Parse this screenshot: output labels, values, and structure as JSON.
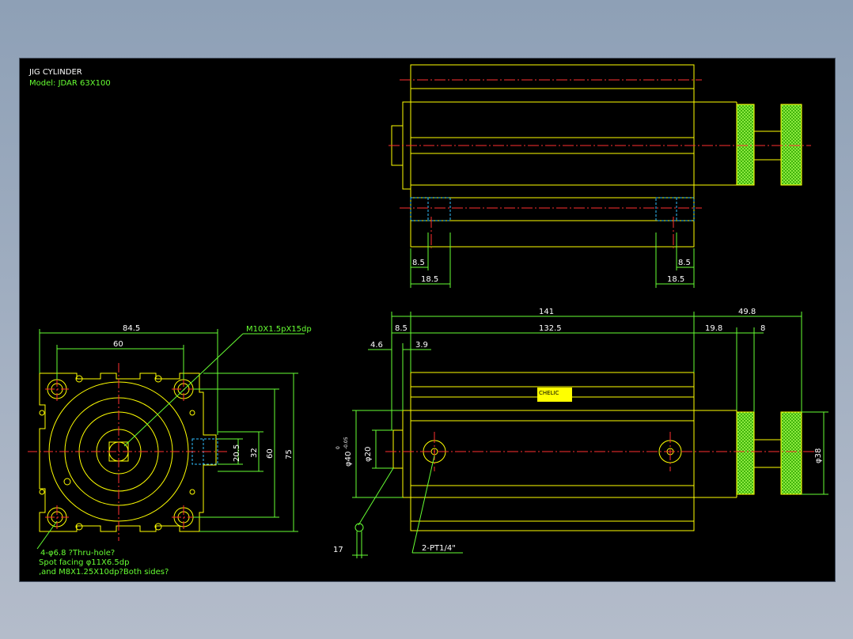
{
  "title_block": {
    "title": "JIG CYLINDER",
    "model": "Model: JDAR 63X100"
  },
  "colors": {
    "background": "#000000",
    "outline": "#ffff00",
    "centerline": "#ff3030",
    "dimension": "#66ff33",
    "hidden": "#30c0ff",
    "text": "#ffffff"
  },
  "front_view": {
    "dims": {
      "width_outer": "84.5",
      "width_holes": "60",
      "height_75": "75",
      "height_60": "60",
      "height_32": "32",
      "height_20_5": "20.5"
    },
    "thread_callout": "M10X1.5pX15dp",
    "note_line1": "4-φ6.8 ?Thru-hole?",
    "note_line2": "Spot facing φ11X6.5dp",
    "note_line3": ",and M8X1.25X10dp?Both sides?"
  },
  "top_view": {
    "dims": {
      "left_small": "8.5",
      "left_large": "18.5",
      "right_small": "8.5",
      "right_large": "18.5"
    }
  },
  "side_view": {
    "dims": {
      "overall": "141",
      "rod_ext": "49.8",
      "head": "8.5",
      "body": "132.5",
      "d19_8": "19.8",
      "d8": "8",
      "d4_6": "4.6",
      "d3_9": "3.9",
      "dia40": "φ40",
      "dia40_tol_upper": "0",
      "dia40_tol_lower": "-0.05",
      "dia20": "φ20",
      "dia38": "φ38",
      "d17": "17"
    },
    "port_callout": "2-PT1/4\"",
    "label_plate": "CHELIC"
  }
}
